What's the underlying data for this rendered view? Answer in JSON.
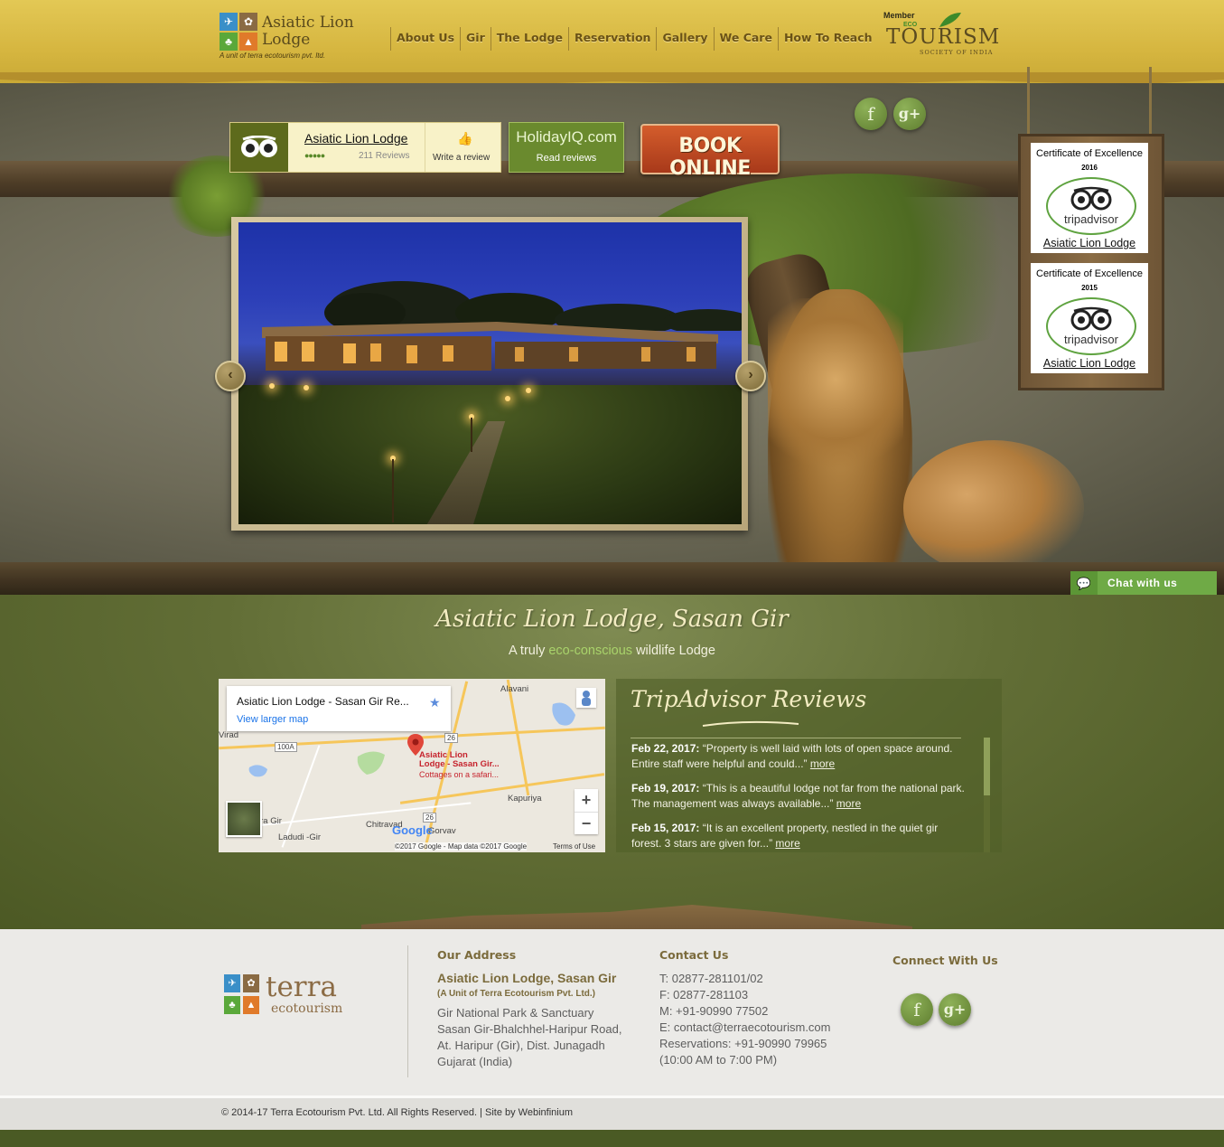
{
  "brand": {
    "name_line1": "Asiatic Lion",
    "name_line2": "Lodge",
    "tagline": "A unit of terra ecotourism pvt. ltd."
  },
  "nav": {
    "items": [
      "About Us",
      "Gir",
      "The Lodge",
      "Reservation",
      "Gallery",
      "We Care",
      "How To Reach"
    ]
  },
  "eco_badge": {
    "member": "Member",
    "title": "TOURISM",
    "prefix": "ECO",
    "subtitle": "SOCIETY OF INDIA"
  },
  "tripadvisor_widget": {
    "name": "Asiatic Lion Lodge",
    "rating_bubbles": 5,
    "reviews_count": "211 Reviews",
    "write_review": "Write a review"
  },
  "holidayiq": {
    "title": "HolidayIQ.com",
    "sub": "Read reviews"
  },
  "book_online": "BOOK ONLINE",
  "header_social": {
    "facebook": "f",
    "googleplus": "g+"
  },
  "certificates": [
    {
      "title": "Certificate of Excellence",
      "year": "2016",
      "brand": "tripadvisor",
      "link": "Asiatic Lion Lodge"
    },
    {
      "title": "Certificate of Excellence",
      "year": "2015",
      "brand": "tripadvisor",
      "link": "Asiatic Lion Lodge"
    }
  ],
  "slider": {
    "prev": "‹",
    "next": "›"
  },
  "chat": {
    "label": "Chat with us"
  },
  "intro": {
    "title": "Asiatic Lion Lodge, Sasan Gir",
    "sub_before": "A truly ",
    "sub_highlight": "eco-conscious",
    "sub_after": " wildlife Lodge"
  },
  "map": {
    "card_title": "Asiatic Lion Lodge - Sasan Gir Re...",
    "view_larger": "View larger map",
    "pin_label_1": "Asiatic Lion",
    "pin_label_2": "Lodge - Sasan Gir...",
    "pin_sub": "Cottages on a safari...",
    "places": [
      "Alavani",
      "Kapuriya",
      "Chitravad",
      "Ladudi -Gir",
      "ira Gir",
      "Virad",
      "Gorvav"
    ],
    "road_badges": [
      "100A",
      "26",
      "26"
    ],
    "zoom_in": "+",
    "zoom_out": "−",
    "google": "Google",
    "attribution": "©2017 Google - Map data ©2017 Google",
    "terms": "Terms of Use"
  },
  "reviews": {
    "title": "TripAdvisor Reviews",
    "items": [
      {
        "date": "Feb 22, 2017:",
        "text": " “Property is well laid with lots of open space around. Entire staff were helpful and could...” ",
        "more": "more"
      },
      {
        "date": "Feb 19, 2017:",
        "text": " “This is a beautiful lodge not far from the national park. The management was always available...” ",
        "more": "more"
      },
      {
        "date": "Feb 15, 2017:",
        "text": " “It is an excellent property, nestled in the quiet gir forest. 3 stars are given for...” ",
        "more": "more"
      }
    ]
  },
  "footer": {
    "logo_word": "terra",
    "logo_sub": "ecotourism",
    "address_heading": "Our Address",
    "address_name": "Asiatic Lion Lodge, Sasan Gir",
    "address_unit": "(A Unit of Terra Ecotourism Pvt. Ltd.)",
    "address_lines": [
      "Gir National Park & Sanctuary",
      "Sasan Gir-Bhalchhel-Haripur Road,",
      "At. Haripur (Gir), Dist. Junagadh",
      "Gujarat (India)"
    ],
    "contact_heading": "Contact Us",
    "contact_lines": [
      "T: 02877-281101/02",
      "F: 02877-281103",
      "M: +91-90990 77502",
      "E: contact@terraecotourism.com",
      "Reservations: +91-90990 79965",
      "(10:00 AM to 7:00 PM)"
    ],
    "connect_heading": "Connect With Us",
    "social_fb": "f",
    "social_gp": "g+",
    "copyright": "© 2014-17 Terra Ecotourism Pvt. Ltd. All Rights Reserved.  |  Site by Webinfinium"
  },
  "colors": {
    "header": "#d6b640",
    "green_section": "#626e36",
    "accent_green": "#6faa46",
    "book_online": "#c24a22",
    "footer": "#ebeae7",
    "highlight": "#a9d36b"
  }
}
